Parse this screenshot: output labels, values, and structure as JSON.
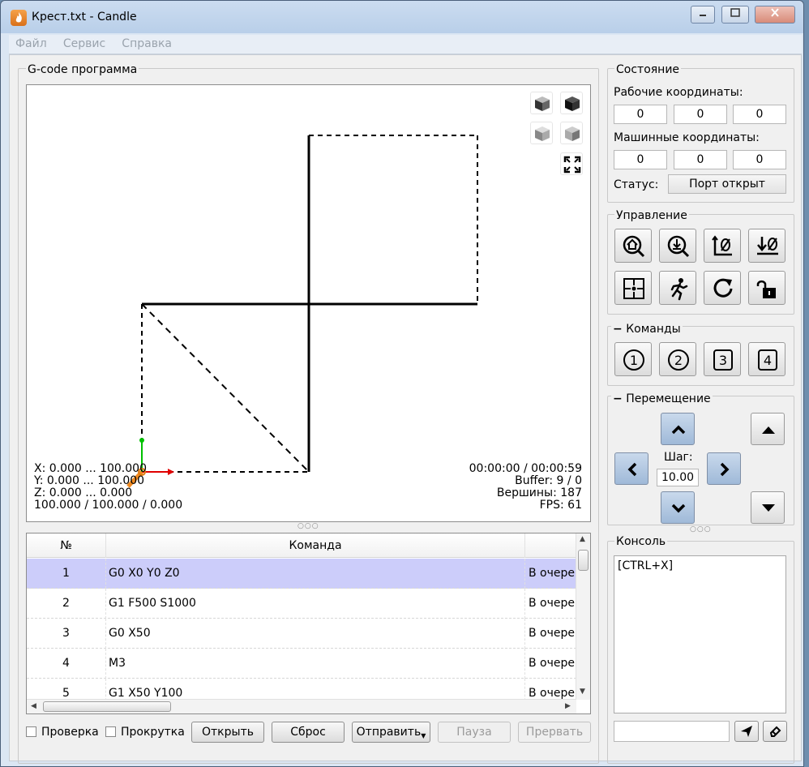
{
  "window": {
    "title": "Крест.txt - Candle",
    "app_icon_glyph": "🜂"
  },
  "menu": [
    "Файл",
    "Сервис",
    "Справка"
  ],
  "gcode_group": {
    "title": "G-code программа"
  },
  "viewport": {
    "left_info": [
      "X: 0.000 ... 100.000",
      "Y: 0.000 ... 100.000",
      "Z: 0.000 ... 0.000",
      "100.000 / 100.000 / 0.000"
    ],
    "right_info": [
      "00:00:00 / 00:00:59",
      "Buffer: 9 / 0",
      "Вершины: 187",
      "FPS: 61"
    ]
  },
  "table": {
    "columns": [
      "№",
      "Команда",
      ""
    ],
    "rows": [
      {
        "n": "1",
        "cmd": "G0 X0 Y0 Z0",
        "state": "В очере,",
        "selected": true
      },
      {
        "n": "2",
        "cmd": "G1 F500 S1000",
        "state": "В очере,"
      },
      {
        "n": "3",
        "cmd": "G0 X50",
        "state": "В очере,"
      },
      {
        "n": "4",
        "cmd": "M3",
        "state": "В очере,"
      },
      {
        "n": "5",
        "cmd": "G1 X50 Y100",
        "state": "В очере,"
      }
    ]
  },
  "bottom": {
    "check_label": "Проверка",
    "scroll_label": "Прокрутка",
    "open": "Открыть",
    "reset": "Сброс",
    "send": "Отправить",
    "pause": "Пауза",
    "abort": "Прервать"
  },
  "state": {
    "title": "Состояние",
    "work_label": "Рабочие координаты:",
    "work": [
      "0",
      "0",
      "0"
    ],
    "machine_label": "Машинные координаты:",
    "machine": [
      "0",
      "0",
      "0"
    ],
    "status_label": "Статус:",
    "status": "Порт открыт"
  },
  "control": {
    "title": "Управление"
  },
  "commands": {
    "title": "Команды",
    "buttons": [
      "1",
      "2",
      "3",
      "4"
    ]
  },
  "jog": {
    "title": "Перемещение",
    "step_label": "Шаг:",
    "step": "10.00"
  },
  "console": {
    "title": "Консоль",
    "text": "[CTRL+X]",
    "input": ""
  },
  "colors": {
    "selection": "#cccdfa",
    "jog_blue": "#a9c2e0"
  }
}
